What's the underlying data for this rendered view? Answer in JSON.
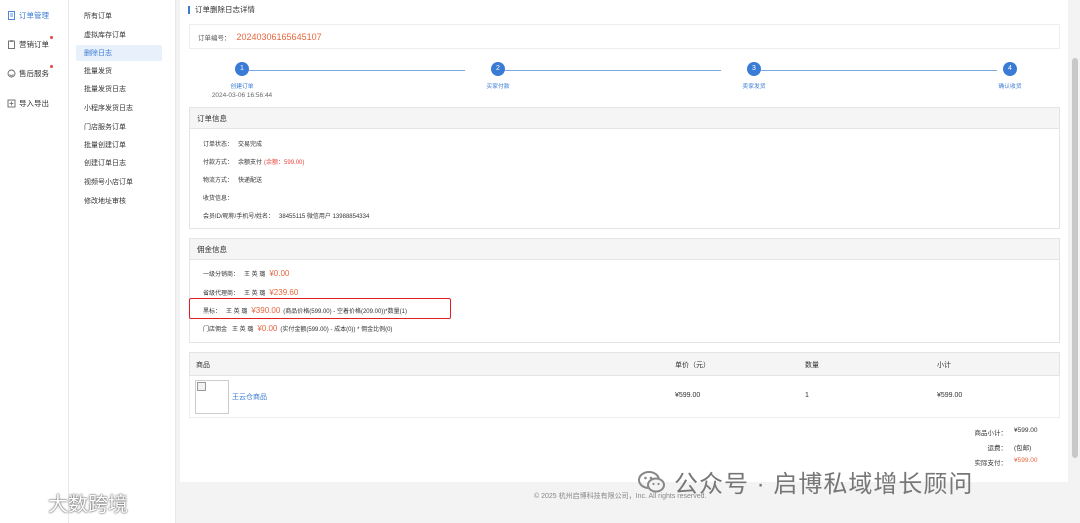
{
  "nav_main": {
    "items": [
      {
        "label": "订单管理",
        "icon": "document-icon",
        "active": true,
        "dot": false
      },
      {
        "label": "营销订单",
        "icon": "clipboard-icon",
        "active": false,
        "dot": true
      },
      {
        "label": "售后服务",
        "icon": "service-icon",
        "active": false,
        "dot": true
      },
      {
        "label": "导入导出",
        "icon": "import-export-icon",
        "active": false,
        "dot": false
      }
    ]
  },
  "nav_sub": {
    "items": [
      {
        "label": "所有订单",
        "active": false
      },
      {
        "label": "虚拟库存订单",
        "active": false
      },
      {
        "label": "删除日志",
        "active": true
      },
      {
        "label": "批量发货",
        "active": false
      },
      {
        "label": "批量发货日志",
        "active": false
      },
      {
        "label": "小程序发货日志",
        "active": false
      },
      {
        "label": "门店服务订单",
        "active": false
      },
      {
        "label": "批量创建订单",
        "active": false
      },
      {
        "label": "创建订单日志",
        "active": false
      },
      {
        "label": "视频号小店订单",
        "active": false
      },
      {
        "label": "修改地址审核",
        "active": false
      }
    ]
  },
  "page": {
    "title": "订单删除日志详情",
    "order_label": "订单编号：",
    "order_number": "20240306165645107"
  },
  "steps": [
    {
      "num": "1",
      "label": "创建订单",
      "time": "2024-03-06 16:56:44"
    },
    {
      "num": "2",
      "label": "买家付款",
      "time": ""
    },
    {
      "num": "3",
      "label": "卖家发货",
      "time": ""
    },
    {
      "num": "4",
      "label": "确认收货",
      "time": ""
    }
  ],
  "order_info": {
    "heading": "订单信息",
    "status_label": "订单状态：",
    "status_value": "交易完成",
    "pay_label": "付款方式：",
    "pay_value": "余额支付",
    "pay_detail": "(余额：599.00)",
    "ship_label": "物流方式：",
    "ship_value": "快递配送",
    "receive_label": "收货信息：",
    "member_label": "会员ID/昵称/手机号/姓名：",
    "member_value": "38455115  微信用户   13988854334"
  },
  "commission": {
    "heading": "佣金信息",
    "level1_label": "一级分销商：",
    "level1_name": "王 英 璐",
    "level1_amount": "¥0.00",
    "province_label": "省级代理商：",
    "province_name": "王 英 璐",
    "province_amount": "¥239.60",
    "blackcard_label": "黑标：",
    "blackcard_name": "王 英 璐",
    "blackcard_amount": "¥390.00",
    "blackcard_formula": "(商品价格(599.00) - 空着价格(209.00))*数量(1)",
    "store_label": "门店佣金",
    "store_name": "王 英 璐",
    "store_amount": "¥0.00",
    "store_formula": "(实付金额(599.00) - 成本(0)) * 佣金比例(0)"
  },
  "goods": {
    "headers": [
      "商品",
      "单价（元）",
      "数量",
      "小计"
    ],
    "rows": [
      {
        "name": "王云仓商品",
        "price": "¥599.00",
        "qty": "1",
        "subtotal": "¥599.00"
      }
    ]
  },
  "summary": {
    "subtotal_label": "商品小计：",
    "subtotal_value": "¥599.00",
    "freight_label": "运费：",
    "freight_value": "(包邮)",
    "paid_label": "实际支付：",
    "paid_value": "¥599.00"
  },
  "footer": {
    "copyright": "© 2025 杭州启博科技有限公司，Inc. All rights reserved."
  },
  "watermarks": {
    "right": "公众号 · 启博私域增长顾问",
    "left": "大数跨境"
  },
  "colors": {
    "accent": "#3a7bd5",
    "price": "#e8663d",
    "alert": "#e02020"
  }
}
